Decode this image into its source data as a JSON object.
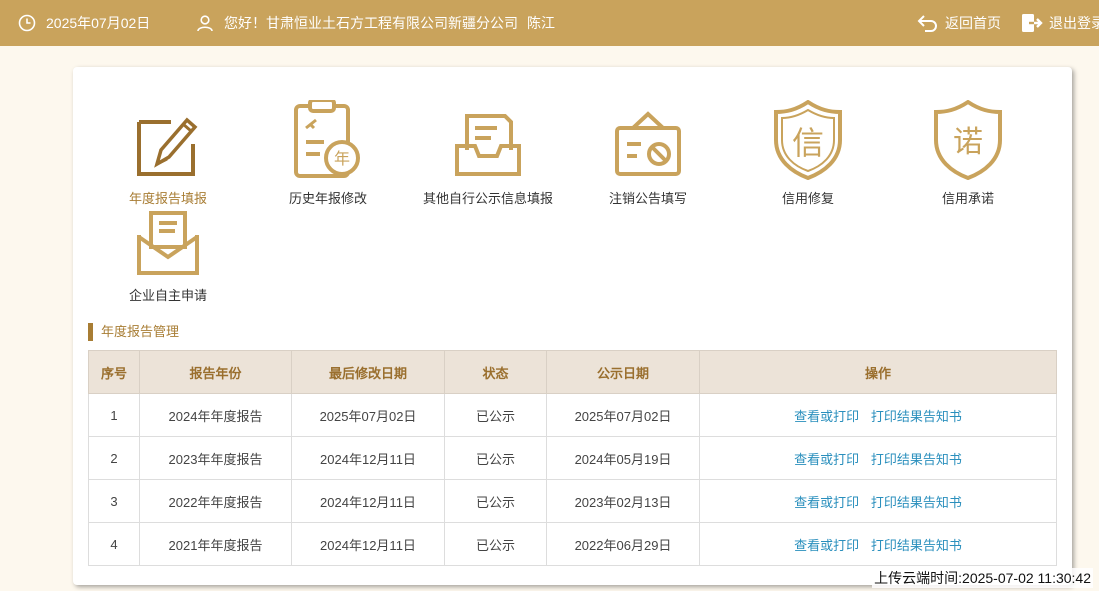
{
  "header": {
    "date": "2025年07月02日",
    "greeting": "您好！甘肃恒业土石方工程有限公司新疆分公司",
    "user": "陈江",
    "home_label": "返回首页",
    "logout_label": "退出登录"
  },
  "functions": [
    {
      "label": "年度报告填报",
      "icon": "pencil-edit-icon"
    },
    {
      "label": "历史年报修改",
      "icon": "clipboard-year-icon"
    },
    {
      "label": "其他自行公示信息填报",
      "icon": "inbox-tray-icon"
    },
    {
      "label": "注销公告填写",
      "icon": "cancel-notice-icon"
    },
    {
      "label": "信用修复",
      "icon": "shield-credit-icon"
    },
    {
      "label": "信用承诺",
      "icon": "shield-promise-icon"
    },
    {
      "label": "企业自主申请",
      "icon": "envelope-letter-icon"
    }
  ],
  "section_title": "年度报告管理",
  "table": {
    "headers": [
      "序号",
      "报告年份",
      "最后修改日期",
      "状态",
      "公示日期",
      "操作"
    ],
    "rows": [
      {
        "no": "1",
        "year": "2024年年度报告",
        "modified": "2025年07月02日",
        "status": "已公示",
        "published": "2025年07月02日",
        "action1": "查看或打印",
        "action2": "打印结果告知书"
      },
      {
        "no": "2",
        "year": "2023年年度报告",
        "modified": "2024年12月11日",
        "status": "已公示",
        "published": "2024年05月19日",
        "action1": "查看或打印",
        "action2": "打印结果告知书"
      },
      {
        "no": "3",
        "year": "2022年年度报告",
        "modified": "2024年12月11日",
        "status": "已公示",
        "published": "2023年02月13日",
        "action1": "查看或打印",
        "action2": "打印结果告知书"
      },
      {
        "no": "4",
        "year": "2021年年度报告",
        "modified": "2024年12月11日",
        "status": "已公示",
        "published": "2022年06月29日",
        "action1": "查看或打印",
        "action2": "打印结果告知书"
      }
    ]
  },
  "footer": {
    "upload_time": "上传云端时间:2025-07-02 11:30:42"
  },
  "colors": {
    "brand": "#c9a35c",
    "accent": "#a87d34",
    "link": "#2a8fbd"
  }
}
